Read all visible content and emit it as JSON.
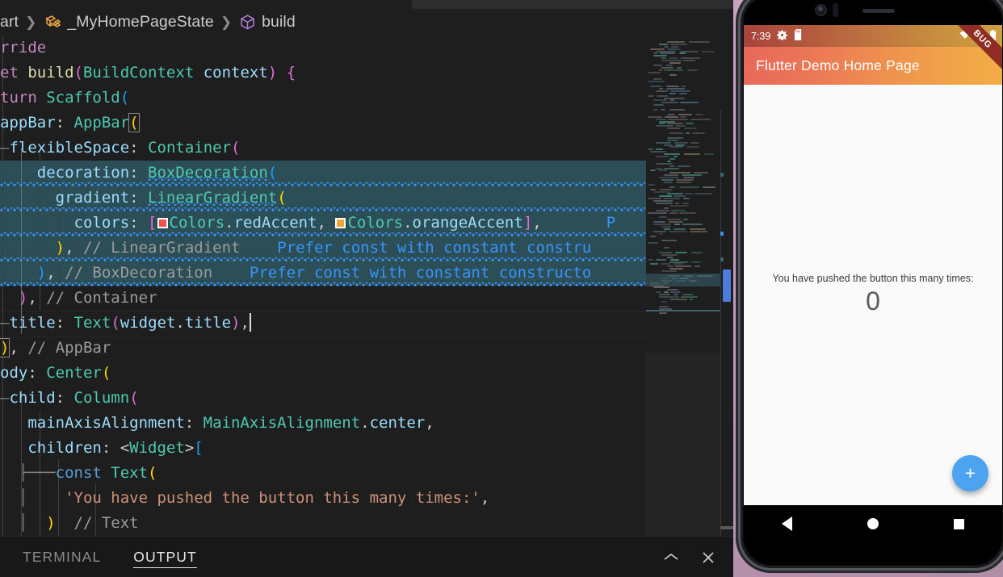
{
  "window": {
    "accent_blue": "#3794ff",
    "editor_bg": "#1e1e1e",
    "selection_bg": "#2c4f57"
  },
  "breadcrumb": {
    "items": [
      {
        "label": "art",
        "icon": ""
      },
      {
        "label": "_MyHomePageState",
        "icon": "class-icon"
      },
      {
        "label": "build",
        "icon": "method-cube-icon"
      }
    ],
    "separator": "❯"
  },
  "editor": {
    "lines": [
      {
        "selected": false,
        "tokens": [
          {
            "text": "rride",
            "cls": "t-kw"
          }
        ]
      },
      {
        "selected": false,
        "tokens": [
          {
            "text": "et ",
            "cls": "t-kw"
          },
          {
            "text": "build",
            "cls": "t-fn"
          },
          {
            "text": "(",
            "cls": "t-b2"
          },
          {
            "text": "BuildContext",
            "cls": "t-cls"
          },
          {
            "text": " context",
            "cls": "t-var"
          },
          {
            "text": ")",
            "cls": "t-b2"
          },
          {
            "text": " ",
            "cls": "t-punc"
          },
          {
            "text": "{",
            "cls": "t-b2"
          }
        ]
      },
      {
        "selected": false,
        "tokens": [
          {
            "text": "turn ",
            "cls": "t-kw"
          },
          {
            "text": "Scaffold",
            "cls": "t-cls"
          },
          {
            "text": "(",
            "cls": "t-b3"
          }
        ]
      },
      {
        "selected": false,
        "tokens": [
          {
            "text": "appBar",
            "cls": "t-var"
          },
          {
            "text": ": ",
            "cls": "t-punc"
          },
          {
            "text": "AppBar",
            "cls": "t-cls"
          },
          {
            "text": "(",
            "cls": "t-b1",
            "match": true
          }
        ]
      },
      {
        "selected": false,
        "tokens": [
          {
            "text": "—",
            "cls": "conn"
          },
          {
            "text": "flexibleSpace",
            "cls": "t-var"
          },
          {
            "text": ": ",
            "cls": "t-punc"
          },
          {
            "text": "Container",
            "cls": "t-cls"
          },
          {
            "text": "(",
            "cls": "t-b2"
          }
        ]
      },
      {
        "selected": true,
        "tokens": [
          {
            "text": "    decoration",
            "cls": "t-var"
          },
          {
            "text": ": ",
            "cls": "t-punc"
          },
          {
            "text": "BoxDecoration",
            "cls": "t-cls",
            "squiggle": true
          },
          {
            "text": "(",
            "cls": "t-b3"
          }
        ]
      },
      {
        "selected": true,
        "tokens": [
          {
            "text": "      gradient",
            "cls": "t-var"
          },
          {
            "text": ": ",
            "cls": "t-punc"
          },
          {
            "text": "LinearGradient",
            "cls": "t-cls",
            "squiggle": true
          },
          {
            "text": "(",
            "cls": "t-b1"
          }
        ]
      },
      {
        "selected": true,
        "tokens": [
          {
            "text": "        colors",
            "cls": "t-var"
          },
          {
            "text": ": ",
            "cls": "t-punc"
          },
          {
            "text": "[",
            "cls": "t-b2"
          },
          {
            "swatch": "#ef5350"
          },
          {
            "text": "Colors",
            "cls": "t-cls"
          },
          {
            "text": ".",
            "cls": "t-punc"
          },
          {
            "text": "redAccent",
            "cls": "t-var"
          },
          {
            "text": ", ",
            "cls": "t-punc"
          },
          {
            "swatch": "#eca63a"
          },
          {
            "text": "Colors",
            "cls": "t-cls"
          },
          {
            "text": ".",
            "cls": "t-punc"
          },
          {
            "text": "orangeAccent",
            "cls": "t-var"
          },
          {
            "text": "]",
            "cls": "t-b2"
          },
          {
            "text": ",",
            "cls": "t-punc"
          },
          {
            "text": "       P",
            "cls": "t-hint"
          }
        ]
      },
      {
        "selected": true,
        "tokens": [
          {
            "text": "      ",
            "cls": "t-punc"
          },
          {
            "text": ")",
            "cls": "t-b1"
          },
          {
            "text": ",",
            "cls": "t-punc"
          },
          {
            "text": " // LinearGradient",
            "cls": "t-comg"
          },
          {
            "text": "    Prefer const with constant constru",
            "cls": "t-hint"
          }
        ]
      },
      {
        "selected": true,
        "tokens": [
          {
            "text": "    ",
            "cls": "t-punc"
          },
          {
            "text": ")",
            "cls": "t-b3"
          },
          {
            "text": ",",
            "cls": "t-punc"
          },
          {
            "text": " // BoxDecoration",
            "cls": "t-comg"
          },
          {
            "text": "    Prefer const with constant constructo",
            "cls": "t-hint"
          }
        ]
      },
      {
        "selected": false,
        "tokens": [
          {
            "text": "  ",
            "cls": "t-punc"
          },
          {
            "text": ")",
            "cls": "t-b2"
          },
          {
            "text": ",",
            "cls": "t-punc"
          },
          {
            "text": " // Container",
            "cls": "t-comg"
          }
        ]
      },
      {
        "selected": false,
        "current": true,
        "tokens": [
          {
            "text": "—",
            "cls": "conn"
          },
          {
            "text": "title",
            "cls": "t-var"
          },
          {
            "text": ": ",
            "cls": "t-punc"
          },
          {
            "text": "Text",
            "cls": "t-cls"
          },
          {
            "text": "(",
            "cls": "t-b2"
          },
          {
            "text": "widget",
            "cls": "t-var"
          },
          {
            "text": ".",
            "cls": "t-punc"
          },
          {
            "text": "title",
            "cls": "t-var"
          },
          {
            "text": ")",
            "cls": "t-b2"
          },
          {
            "text": ",",
            "cls": "t-punc"
          },
          {
            "caret": true
          }
        ]
      },
      {
        "selected": false,
        "tokens": [
          {
            "text": ")",
            "cls": "t-b1",
            "match": true
          },
          {
            "text": ",",
            "cls": "t-punc"
          },
          {
            "text": " // AppBar",
            "cls": "t-comg"
          }
        ]
      },
      {
        "selected": false,
        "tokens": [
          {
            "text": "ody",
            "cls": "t-var"
          },
          {
            "text": ": ",
            "cls": "t-punc"
          },
          {
            "text": "Center",
            "cls": "t-cls"
          },
          {
            "text": "(",
            "cls": "t-b1"
          }
        ]
      },
      {
        "selected": false,
        "tokens": [
          {
            "text": "—",
            "cls": "conn"
          },
          {
            "text": "child",
            "cls": "t-var"
          },
          {
            "text": ": ",
            "cls": "t-punc"
          },
          {
            "text": "Column",
            "cls": "t-cls"
          },
          {
            "text": "(",
            "cls": "t-b2"
          }
        ]
      },
      {
        "selected": false,
        "tokens": [
          {
            "text": "   mainAxisAlignment",
            "cls": "t-var"
          },
          {
            "text": ": ",
            "cls": "t-punc"
          },
          {
            "text": "MainAxisAlignment",
            "cls": "t-cls"
          },
          {
            "text": ".",
            "cls": "t-punc"
          },
          {
            "text": "center",
            "cls": "t-var"
          },
          {
            "text": ",",
            "cls": "t-punc"
          }
        ]
      },
      {
        "selected": false,
        "tokens": [
          {
            "text": "   children",
            "cls": "t-var"
          },
          {
            "text": ": <",
            "cls": "t-punc"
          },
          {
            "text": "Widget",
            "cls": "t-cls"
          },
          {
            "text": ">",
            "cls": "t-punc"
          },
          {
            "text": "[",
            "cls": "t-b3"
          }
        ]
      },
      {
        "selected": false,
        "tokens": [
          {
            "text": "  ├───",
            "cls": "conn"
          },
          {
            "text": "const ",
            "cls": "t-kw2"
          },
          {
            "text": "Text",
            "cls": "t-cls"
          },
          {
            "text": "(",
            "cls": "t-b1"
          }
        ]
      },
      {
        "selected": false,
        "tokens": [
          {
            "text": "  │    ",
            "cls": "conn"
          },
          {
            "text": "'You have pushed the button this many times:'",
            "cls": "t-str"
          },
          {
            "text": ",",
            "cls": "t-punc"
          }
        ]
      },
      {
        "selected": false,
        "tokens": [
          {
            "text": "  │  ",
            "cls": "conn"
          },
          {
            "text": ")",
            "cls": "t-b1"
          },
          {
            "text": "  // Text",
            "cls": "t-comg"
          }
        ]
      }
    ]
  },
  "panel": {
    "tabs": [
      {
        "label": "TERMINAL",
        "active": false
      },
      {
        "label": "OUTPUT",
        "active": true
      }
    ],
    "actions": [
      {
        "name": "maximize-panel",
        "glyph": "⌃"
      },
      {
        "name": "close-panel",
        "glyph": "✕"
      }
    ]
  },
  "device": {
    "status_bar": {
      "time": "7:39",
      "icons": [
        "gear-icon",
        "sd-card-icon",
        "wifi-icon",
        "cellular-signal-icon",
        "battery-icon"
      ]
    },
    "app_bar": {
      "title": "Flutter Demo Home Page"
    },
    "debug_banner": "BUG",
    "body": {
      "label": "You have pushed the button this many times:",
      "counter": "0"
    },
    "fab": {
      "glyph": "+",
      "color": "#4da3f0"
    },
    "nav_bar": [
      "back-button",
      "home-button",
      "recents-button"
    ]
  }
}
